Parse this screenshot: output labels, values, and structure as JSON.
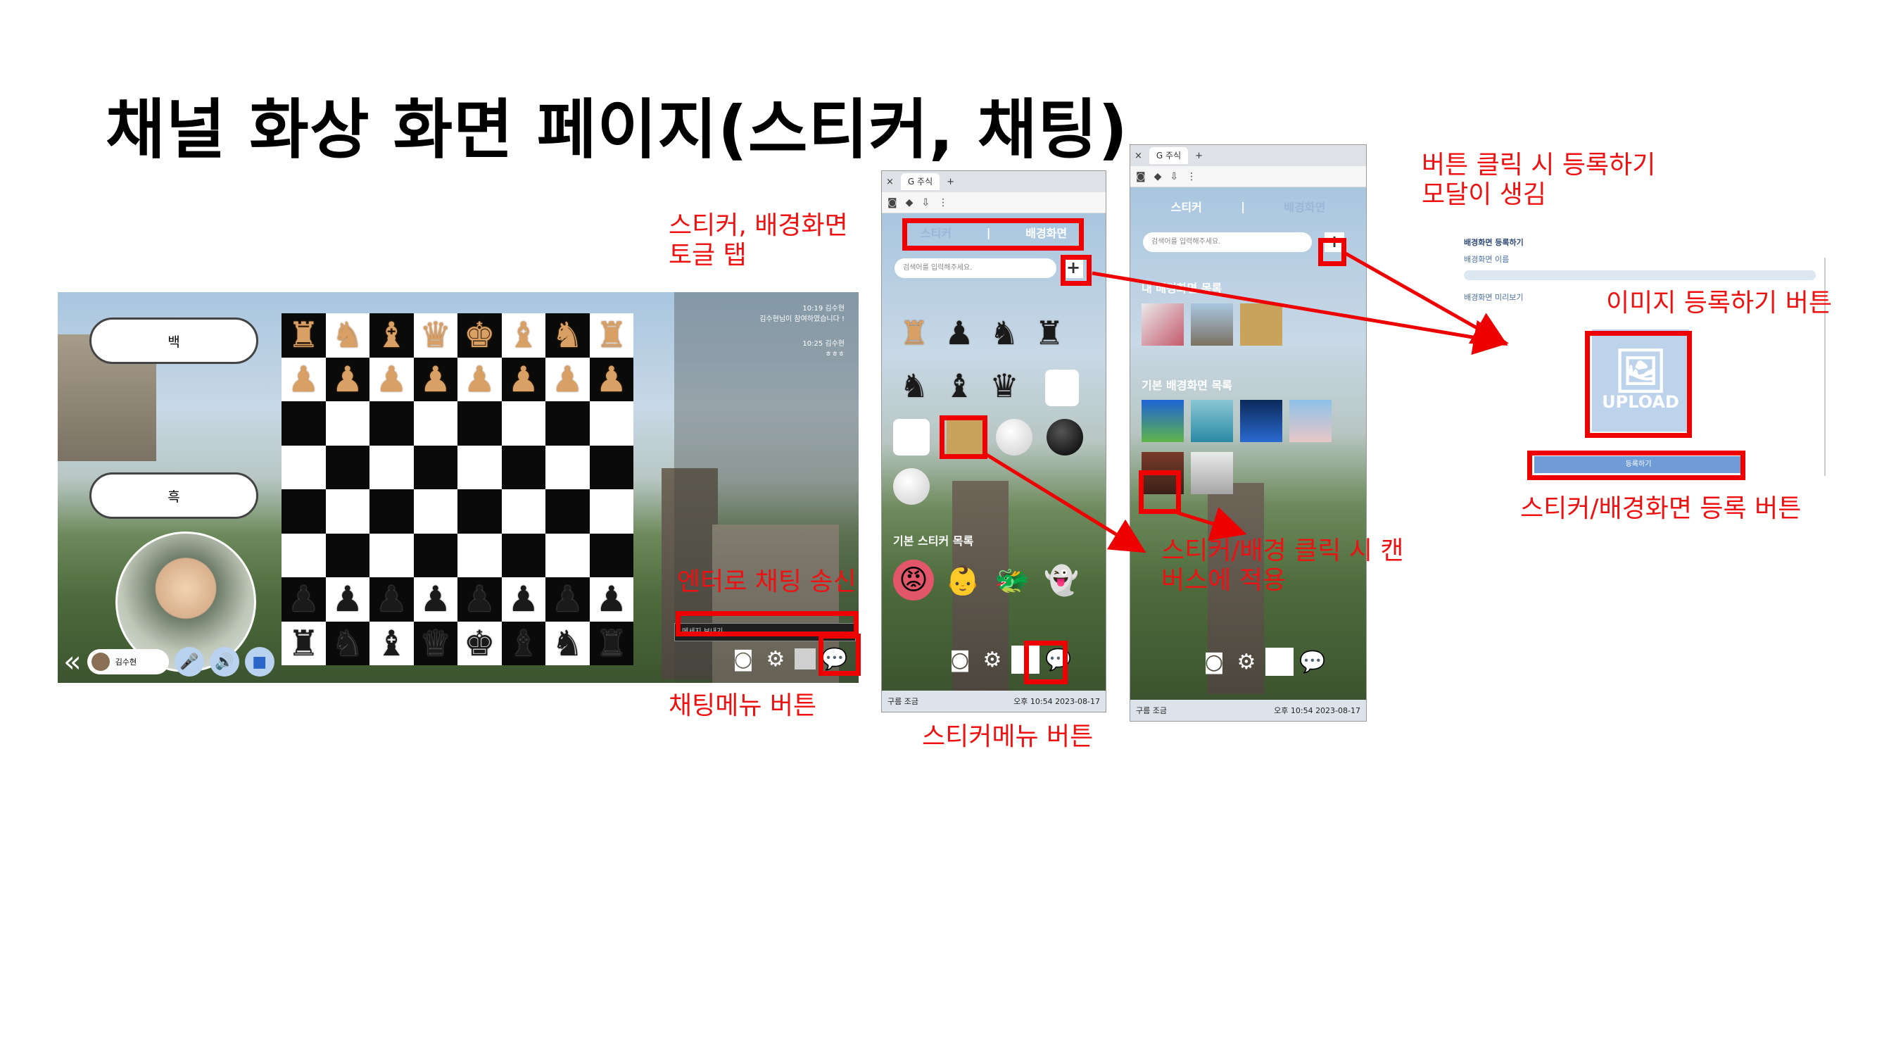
{
  "title": "채널 화상 화면 페이지(스티커, 채팅)",
  "annotations": {
    "toggle_tab": "스티커, 배경화면\n토글 탭",
    "enter_send": "엔터로 채팅 송신",
    "chat_menu_button": "채팅메뉴 버튼",
    "sticker_menu_button": "스티커메뉴 버튼",
    "click_apply": "스티커/배경 클릭 시 캔\n버스에 적용",
    "modal_opens": "버튼 클릭 시 등록하기\n모달이 생김",
    "image_register_button": "이미지 등록하기 버튼",
    "register_button": "스티커/배경화면 등록 버튼"
  },
  "main_screen": {
    "white_button": "백",
    "black_button": "흑",
    "chat": [
      {
        "time": "10:19",
        "name": "김수현",
        "message": "김수현님이 참여하였습니다 !"
      },
      {
        "time": "10:25",
        "name": "김수현",
        "message": "ㅎㅎㅎ"
      }
    ],
    "chat_placeholder": "메세지 보내기",
    "user_name": "김수현",
    "board": {
      "rows": [
        [
          "♜",
          "♞",
          "♝",
          "♛",
          "♚",
          "♝",
          "♞",
          "♜"
        ],
        [
          "♟",
          "♟",
          "♟",
          "♟",
          "♟",
          "♟",
          "♟",
          "♟"
        ],
        [
          "",
          "",
          "",
          "",
          "",
          "",
          "",
          ""
        ],
        [
          "",
          "",
          "",
          "",
          "",
          "",
          "",
          ""
        ],
        [
          "",
          "",
          "",
          "",
          "",
          "",
          "",
          ""
        ],
        [
          "",
          "",
          "",
          "",
          "",
          "",
          "",
          ""
        ],
        [
          "♟",
          "♟",
          "♟",
          "♟",
          "♟",
          "♟",
          "♟",
          "♟"
        ],
        [
          "♜",
          "♞",
          "♝",
          "♛",
          "♚",
          "♝",
          "♞",
          "♜"
        ]
      ]
    }
  },
  "sticker_phone": {
    "tab_label": "주식",
    "tab_sticker": "스티커",
    "tab_divider": "|",
    "tab_background": "배경화면",
    "search_placeholder": "검색어를 입력해주세요.",
    "plus": "+",
    "default_title": "기본 스티커 목록",
    "taskbar_left": "구름 조금",
    "taskbar_time": "오후 10:54",
    "taskbar_date": "2023-08-17"
  },
  "bg_phone": {
    "tab_label": "주식",
    "tab_sticker": "스티커",
    "tab_divider": "|",
    "tab_background": "배경화면",
    "search_placeholder": "검색어를 입력해주세요.",
    "plus": "+",
    "my_title": "내 배경화면 목록",
    "default_title": "기본 배경화면 목록",
    "taskbar_left": "구름 조금",
    "taskbar_time": "오후 10:54",
    "taskbar_date": "2023-08-17"
  },
  "modal": {
    "title": "배경화면 등록하기",
    "name_label": "배경화면 이름",
    "preview_label": "배경화면 미리보기",
    "upload_text": "UPLOAD",
    "register_text": "등록하기"
  },
  "colors": {
    "annotation_red": "#ee1111",
    "upload_tile": "#bcd3eb",
    "register_button": "#6f9bd6"
  }
}
